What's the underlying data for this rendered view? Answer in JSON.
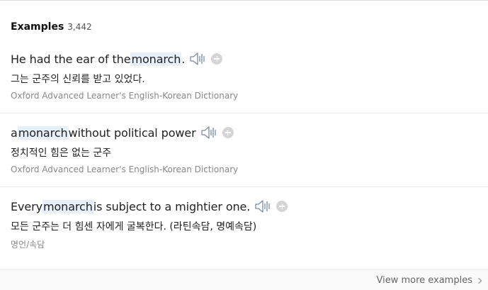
{
  "section": {
    "title": "Examples",
    "count": "3,442"
  },
  "examples": [
    {
      "before": "He had the ear of the ",
      "highlight": "monarch",
      "after": ".",
      "translation": "그는 군주의 신뢰를 받고 있었다.",
      "source": "Oxford Advanced Learner's English-Korean Dictionary"
    },
    {
      "before": "a ",
      "highlight": "monarch",
      "after": " without political power",
      "translation": "정치적인 힘은 없는 군주",
      "source": "Oxford Advanced Learner's English-Korean Dictionary"
    },
    {
      "before": "Every ",
      "highlight": "monarch",
      "after": " is subject to a mightier one.",
      "translation": "모든 군주는 더 힘센 자에게 굴복한다. (라틴속담, 명예속담)",
      "source": "명언/속담"
    }
  ],
  "footer": {
    "view_more_label": "View more examples"
  },
  "icons": {
    "audio": "speaker-icon",
    "add": "plus-icon",
    "more": "chevron-right-icon"
  },
  "colors": {
    "highlight_bg": "#e7f0fb",
    "icon_gray": "#d5d5d5",
    "source_text": "#888888"
  }
}
